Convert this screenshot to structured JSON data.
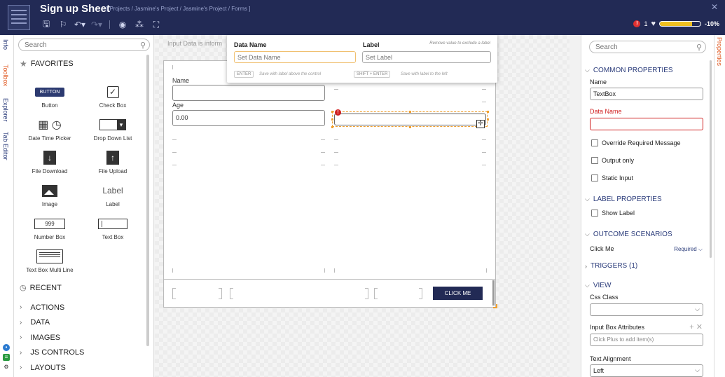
{
  "header": {
    "title": "Sign up Sheet",
    "breadcrumb": "[ Projects / Jasmine's Project / Jasmine's Project / Forms ]",
    "alert_count": "1",
    "progress_fraction": 0.8,
    "progress_label": "-10%",
    "close": "✕",
    "toolbar_icons": [
      "save-icon",
      "flag-icon",
      "undo-icon",
      "redo-icon",
      "preview-icon",
      "tree-icon",
      "fullscreen-icon"
    ]
  },
  "left_tabs": [
    "Info",
    "Toolbox",
    "Explorer",
    "Tab Editor"
  ],
  "toolbox": {
    "search_placeholder": "Search",
    "favorites_label": "FAVORITES",
    "tools": [
      {
        "label": "Button",
        "glyph": "BUTTON"
      },
      {
        "label": "Check Box",
        "glyph": "✓"
      },
      {
        "label": "Date Time Picker",
        "glyph": "📅🕓"
      },
      {
        "label": "Drop Down List",
        "glyph": ""
      },
      {
        "label": "File Download",
        "glyph": "↓"
      },
      {
        "label": "File Upload",
        "glyph": "↑"
      },
      {
        "label": "Image",
        "glyph": ""
      },
      {
        "label": "Label",
        "glyph": "Label"
      },
      {
        "label": "Number Box",
        "glyph": "999"
      },
      {
        "label": "Text Box",
        "glyph": ""
      },
      {
        "label": "Text Box Multi Line",
        "glyph": ""
      }
    ],
    "recent_label": "RECENT",
    "categories": [
      "ACTIONS",
      "DATA",
      "IMAGES",
      "JS CONTROLS",
      "LAYOUTS"
    ]
  },
  "canvas": {
    "info_line": "Input Data is inform",
    "fields": [
      {
        "label": "Name",
        "value": ""
      },
      {
        "label": "Age",
        "value": "0.00"
      }
    ],
    "selected_error": "!",
    "click_button_label": "CLICK ME"
  },
  "popup": {
    "data_name_heading": "Data Name",
    "data_name_placeholder": "Set Data Name",
    "label_heading": "Label",
    "label_placeholder": "Set Label",
    "hint": "Remove value to exclude a label",
    "enter_key": "ENTER",
    "enter_hint": "Save with label above the control",
    "shift_enter_key": "SHIFT + ENTER",
    "shift_enter_hint": "Save with label to the left"
  },
  "properties": {
    "tab_label": "Properties",
    "search_placeholder": "Search",
    "common_heading": "COMMON PROPERTIES",
    "name_label": "Name",
    "name_value": "TextBox",
    "data_name_label": "Data Name",
    "data_name_value": "",
    "override_required": "Override Required Message",
    "output_only": "Output only",
    "static_input": "Static Input",
    "label_heading": "LABEL PROPERTIES",
    "show_label": "Show Label",
    "outcome_heading": "OUTCOME SCENARIOS",
    "click_me": "Click Me",
    "required": "Required",
    "triggers_heading": "TRIGGERS (1)",
    "view_heading": "VIEW",
    "css_class_label": "Css Class",
    "input_box_attr_label": "Input Box Attributes",
    "input_box_attr_placeholder": "Click Plus to add item(s)",
    "text_alignment_label": "Text Alignment",
    "text_alignment_value": "Left"
  },
  "colors": {
    "header": "#222a55",
    "accent": "#e05820",
    "link": "#2a3b7a",
    "error": "#d02020"
  }
}
